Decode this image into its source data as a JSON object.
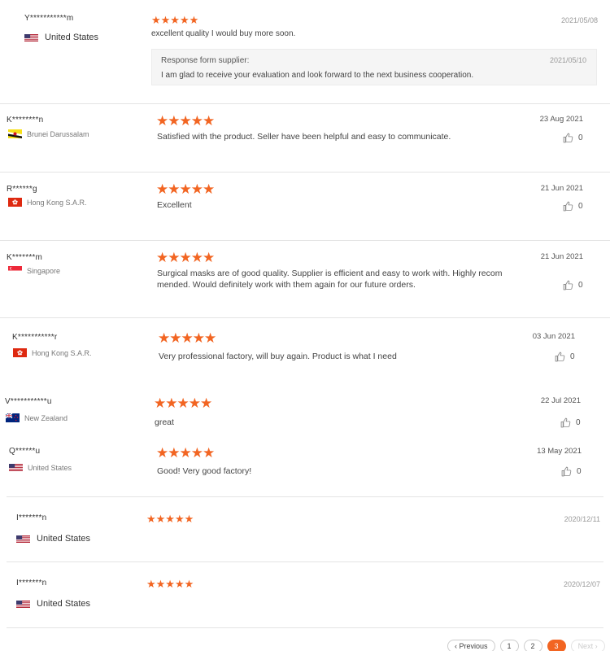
{
  "reviews": [
    {
      "name": "Y***********m",
      "country": "United States",
      "date": "2021/05/08",
      "text": "excellent quality I would buy more soon.",
      "response": {
        "label": "Response form supplier:",
        "date": "2021/05/10",
        "text": "I am glad to receive your evaluation and look forward to the next business cooperation."
      }
    },
    {
      "name": "K********n",
      "country": "Brunei Darussalam",
      "date": "23 Aug 2021",
      "text": "Satisfied with the product. Seller have been helpful and easy to communicate.",
      "likes": "0"
    },
    {
      "name": "R******g",
      "country": "Hong Kong S.A.R.",
      "date": "21 Jun 2021",
      "text": "Excellent",
      "likes": "0"
    },
    {
      "name": "K*******m",
      "country": "Singapore",
      "date": "21 Jun 2021",
      "text_line1": "Surgical masks are of good quality. Supplier is efficient and easy to work with. Highly recom",
      "text_line2": "mended. Would definitely work with them again for our future orders.",
      "likes": "0"
    },
    {
      "name": "K***********r",
      "country": "Hong Kong S.A.R.",
      "date": "03 Jun 2021",
      "text": "Very professional factory, will buy again. Product is what I need",
      "likes": "0"
    },
    {
      "name": "V***********u",
      "country": "New Zealand",
      "date": "22 Jul 2021",
      "text": "great",
      "likes": "0"
    },
    {
      "name": "Q******u",
      "country": "United States",
      "date": "13 May 2021",
      "text": "Good! Very good factory!",
      "likes": "0"
    },
    {
      "name": "I*******n",
      "country": "United States",
      "date": "2020/12/11"
    },
    {
      "name": "I*******n",
      "country": "United States",
      "date": "2020/12/07"
    }
  ],
  "stars": "★★★★★",
  "rating": 5,
  "pagination": {
    "prev": "‹ Previous",
    "pages": [
      "1",
      "2",
      "3"
    ],
    "current": "3",
    "next": "Next ›"
  },
  "colors": {
    "star": "#f26522",
    "active_page": "#f26522"
  },
  "icons": {
    "like": "thumbs-up-icon"
  }
}
